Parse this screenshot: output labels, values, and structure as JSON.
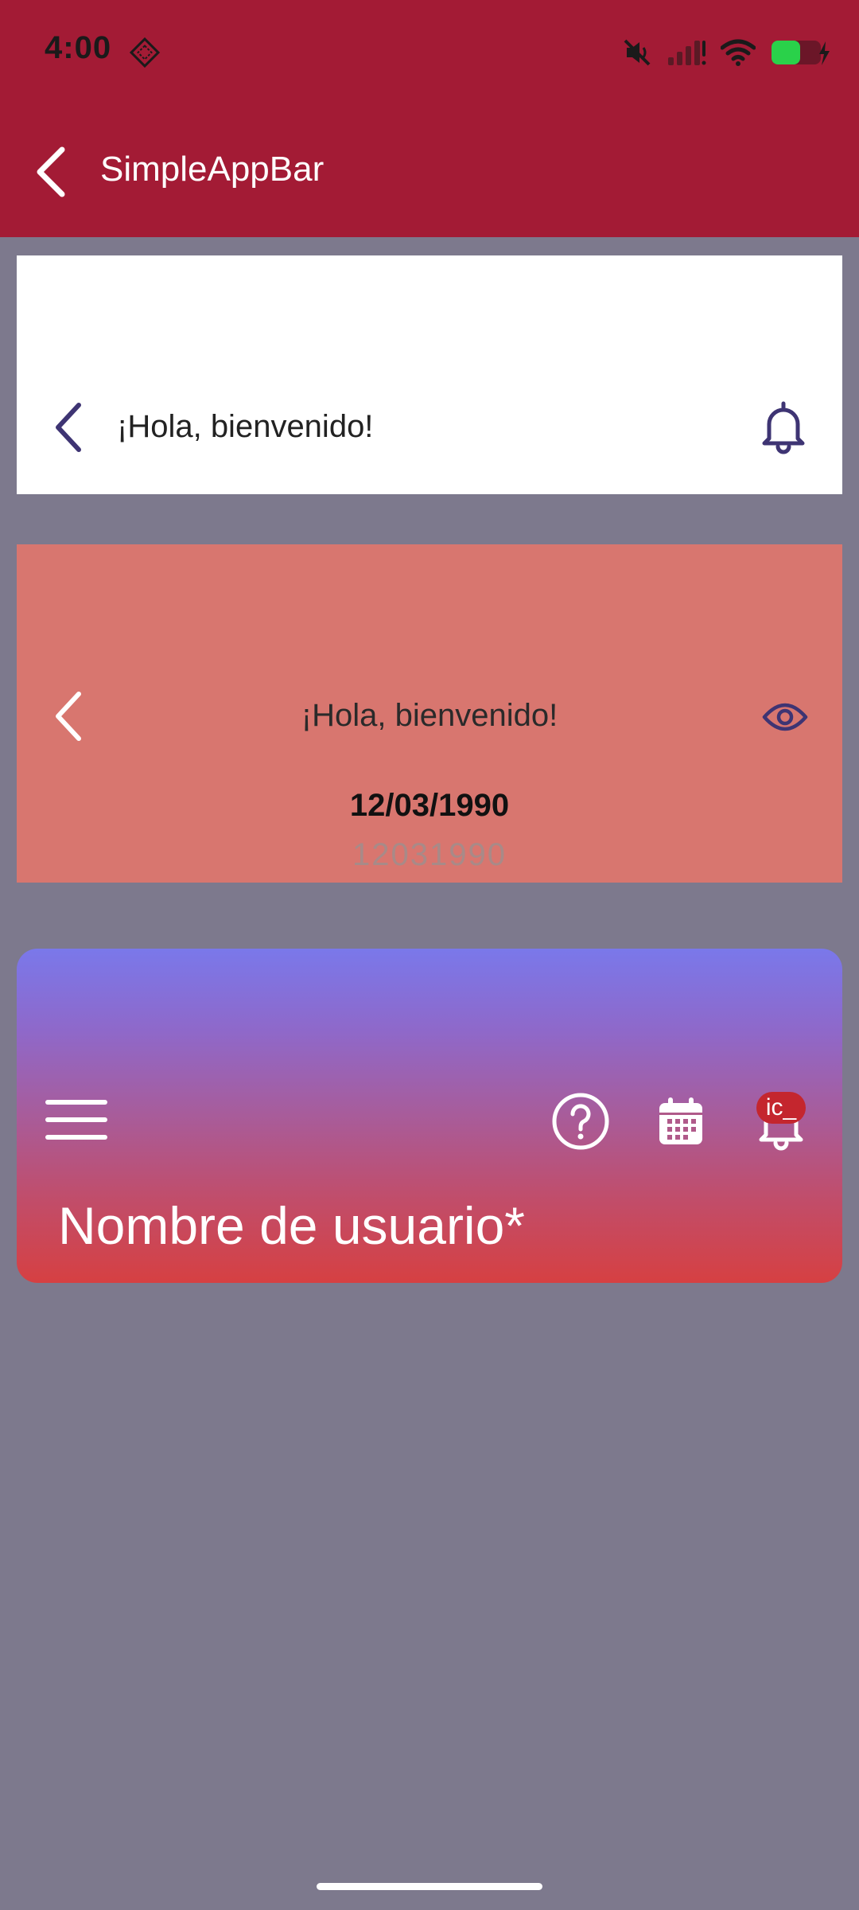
{
  "status_bar": {
    "time": "4:00"
  },
  "app_bar": {
    "title": "SimpleAppBar"
  },
  "card_white": {
    "title": "¡Hola, bienvenido!"
  },
  "card_salmon": {
    "title": "¡Hola, bienvenido!",
    "date": "12/03/1990",
    "date_raw": "12031990"
  },
  "card_gradient": {
    "badge": "ic_",
    "username_label": "Nombre de usuario*"
  },
  "colors": {
    "app_bar": "#a31b35",
    "background": "#7d798d",
    "salmon_card": "#d8766f",
    "gradient_top": "#7a78ea",
    "gradient_bottom": "#d64042",
    "icon_dark": "#3e3473"
  },
  "icons": [
    "diamond-app-icon",
    "mute-icon",
    "signal-icon",
    "wifi-icon",
    "battery-icon",
    "back-chevron-icon",
    "bell-icon",
    "eye-icon",
    "hamburger-menu-icon",
    "help-circle-icon",
    "calendar-icon",
    "notification-bell-icon"
  ]
}
